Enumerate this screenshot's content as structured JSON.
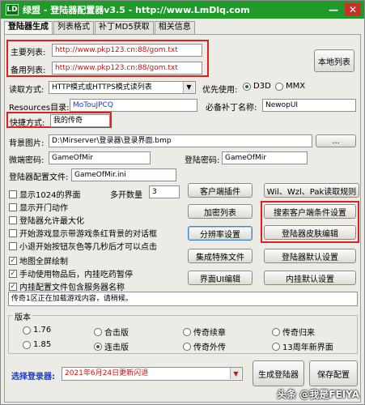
{
  "window": {
    "title": "绿盟 - 登陆器配置器v3.5 - http://www.LmDlq.com",
    "logo_text": "LD"
  },
  "tabs": [
    "登陆器生成",
    "列表格式",
    "补丁MD5获取",
    "相关信息"
  ],
  "main": {
    "primary_list_label": "主要列表:",
    "primary_list_value": "http://www.pkp123.cn:88/gom.txt",
    "backup_list_label": "备用列表:",
    "backup_list_value": "http://www.pkp123.cn:88/gom.txt",
    "local_list_button": "本地列表",
    "read_mode_label": "读取方式:",
    "read_mode_value": "HTTP模式或HTTPS模式读列表",
    "priority_label": "优先使用:",
    "priority_d3d": "D3D",
    "priority_mmx": "MMX",
    "resources_label": "Resources目录:",
    "resources_value": "MoTouJPCQ",
    "patch_name_label": "必备补丁名称:",
    "patch_name_value": "NewopUI",
    "shortcut_label": "快捷方式:",
    "shortcut_value": "我的传奇",
    "bg_image_label": "背景图片:",
    "bg_image_value": "D:\\Mirserver\\登录器\\登录界面.bmp",
    "browse_button": "...",
    "micro_pw_label": "微端密码:",
    "micro_pw_value": "GameOfMir",
    "login_pw_label": "登陆密码:",
    "login_pw_value": "GameOfMir",
    "config_file_label": "登陆器配置文件:",
    "config_file_value": "GameOfMir.ini",
    "wil_button": "Wil、Wzl、Pak读取规则"
  },
  "options": {
    "show_1024": "显示1024的界面",
    "multi_open_label": "多开数量",
    "multi_open_value": "3",
    "show_open_anim": "显示开门动作",
    "allow_maximize": "登陆器允许最大化",
    "bg_dialog": "开始游戏显示带游戏条红背景的对话框",
    "gray_no_click": "小退开始按钮灰色等几秒后才可以点击",
    "fullscreen_map": "地图全屏绘制",
    "manual_items": "手动使用物品后，内挂吃药暂停",
    "include_cfg": "内挂配置文件包含服务器名称"
  },
  "buttons": {
    "client_plugin": "客户端插件",
    "encrypt_list": "加密列表",
    "resolution": "分辨率设置",
    "special_files": "集成特殊文件",
    "ui_edit": "界面UI编辑",
    "search_client": "搜索客户端条件设置",
    "skin_edit": "登陆器皮肤编辑",
    "default_login": "登陆器默认设置",
    "default_plugin": "内挂默认设置"
  },
  "status_text": "传奇1区正在加载游戏内容，请稍候。",
  "version": {
    "title": "版本",
    "items": [
      "1.76",
      "合击版",
      "传奇续章",
      "传奇归来",
      "1.85",
      "连击版",
      "传奇外传",
      "13周年新界面"
    ]
  },
  "footer": {
    "select_label": "选择登录器:",
    "select_value": "2021年6月24日更新闪退",
    "generate_button": "生成登陆器",
    "save_button": "保存配置"
  },
  "watermark": "头条 @我是FEIYA"
}
